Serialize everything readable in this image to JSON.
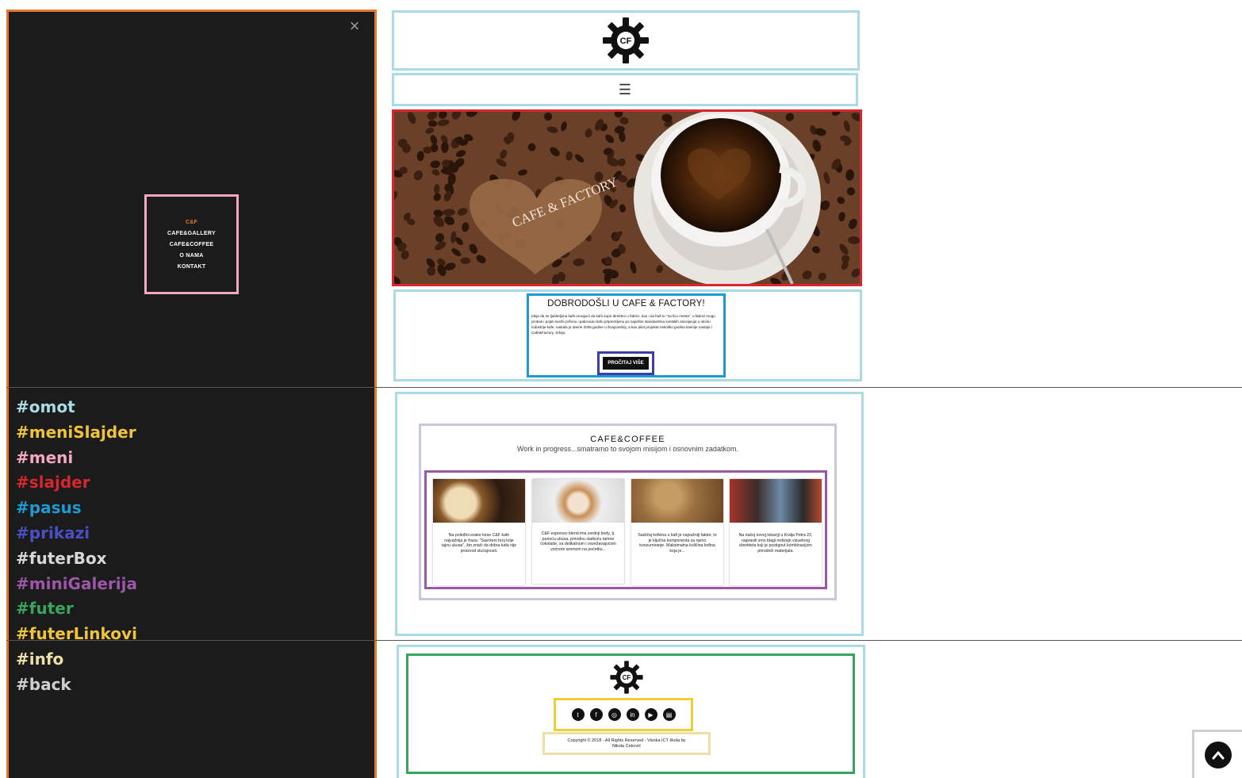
{
  "side_menu": {
    "close_label": "×",
    "items": [
      "C&F",
      "CAFE&GALLERY",
      "CAFE&COFFEE",
      "O NAMA",
      "KONTAKT"
    ]
  },
  "legend": [
    {
      "label": "#omot",
      "color": "#a9dbe6"
    },
    {
      "label": "#meniSlajder",
      "color": "#f0c33c"
    },
    {
      "label": "#meni",
      "color": "#f2a7c2"
    },
    {
      "label": "#slajder",
      "color": "#d7272e"
    },
    {
      "label": "#pasus",
      "color": "#1d9ad1"
    },
    {
      "label": "#prikazi",
      "color": "#4a4fc4"
    },
    {
      "label": "#futerBox",
      "color": "#d8d8d8"
    },
    {
      "label": "#miniGalerija",
      "color": "#9c57a9"
    },
    {
      "label": "#futer",
      "color": "#3aa45c"
    },
    {
      "label": "#futerLinkovi",
      "color": "#f0c33c"
    },
    {
      "label": "#info",
      "color": "#eddfa6"
    },
    {
      "label": "#back",
      "color": "#cfcfcf"
    }
  ],
  "header": {
    "logo_text": "CF",
    "menu_icon": "☰"
  },
  "slider": {
    "logo_text": "CAFE & FACTORY"
  },
  "welcome": {
    "title": "DOBRODOŠLI U CAFE & FACTORY!",
    "text": "Ideja da se ljubiteljima kafe omogući da kafu kupe direktno u fabrici, kao i da baš tu \"na licu mesta\", u fabrici mogu probati i popiti sveže prženu i pakovanu kafu pripremljenu po najvišim standardima svetskih asocijacija u okviru industrije kafe, nastala je davne 2005.godine u Švajcarskoj, a kao pilot projekat nekoliko godina kasnije nastaje i Cafe&Factory, Srbija.",
    "button_label": "PROČITAJ VIŠE"
  },
  "coffee_section": {
    "title": "CAFE&COFFEE",
    "subtitle": "Work in progress...smatramo to svojom misijom i osnovnim zadatkom.",
    "cards": [
      {
        "text": "Na poleđini svake kese C&F kafe najvažnija je fraza: \"Savršeni broj krije tajnu ukusa\", što znači da dobra kafa nije proizvod slučajnosti."
      },
      {
        "text": "C&F espresso blend ima srednji body, tj. punoću ukusa, prirodnu slatkoću tamne čokolade, sa delikatnom i osvežavajućom voćnom aromom na početku..."
      },
      {
        "text": "Sadržaj kofeina u kafi je najvažniji faktor, to je ključna komponenta za njeno konzumiranje. Maksimalna količina kofina koja je..."
      },
      {
        "text": "Na našoj novoj lokaciji u Kralja Petra 22, napravili smo blagi redizajn vizuelnog identiteta koji je postignut kombinacijom prirodnih materijala."
      }
    ]
  },
  "footer": {
    "logo_text": "CF",
    "social": [
      "twitter-icon",
      "facebook-icon",
      "instagram-icon",
      "linkedin-icon",
      "youtube-icon",
      "document-icon"
    ],
    "copyright": "Copyright © 2018 - All Rights Reserved - Visoka ICT škola by Nikola Ćeković"
  }
}
